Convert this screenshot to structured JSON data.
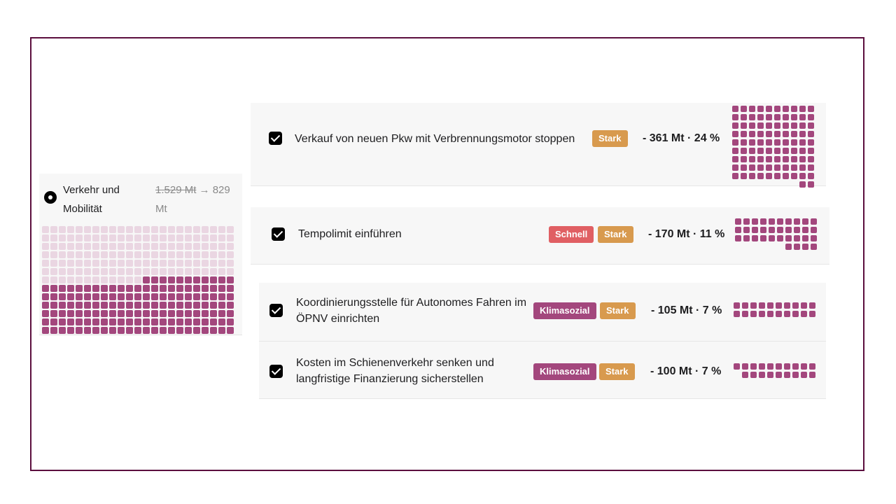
{
  "sector": {
    "name": "Verkehr und Mobilität",
    "value_old": "1.529 Mt",
    "arrow": "→",
    "value_new": "829",
    "unit": "Mt",
    "grid_total": 299,
    "grid_filled": 149,
    "colors": {
      "filled": "#a3477d",
      "remaining": "#ead6e2"
    }
  },
  "measures": [
    {
      "label": "Verkauf von neuen Pkw mit Verbrennungsmotor stoppen",
      "checked": true,
      "tags": [
        "Stark"
      ],
      "stat": "- 361 Mt · 24 %",
      "squares": 92
    },
    {
      "label": "Tempolimit einführen",
      "checked": true,
      "tags": [
        "Schnell",
        "Stark"
      ],
      "stat": "- 170 Mt · 11 %",
      "squares": 34
    },
    {
      "label": "Koordinierungsstelle für Autonomes Fahren im ÖPNV einrichten",
      "checked": true,
      "tags": [
        "Klimasozial",
        "Stark"
      ],
      "stat": "- 105 Mt · 7 %",
      "squares": 20
    },
    {
      "label": "Kosten im Schienenverkehr senken und langfristige Finanzierung sicherstellen",
      "checked": true,
      "tags": [
        "Klimasozial",
        "Stark"
      ],
      "stat": "- 100 Mt · 7 %",
      "squares": 19
    }
  ],
  "tag_colors": {
    "Stark": "#d89a4e",
    "Schnell": "#e05f63",
    "Klimasozial": "#a3477d"
  }
}
